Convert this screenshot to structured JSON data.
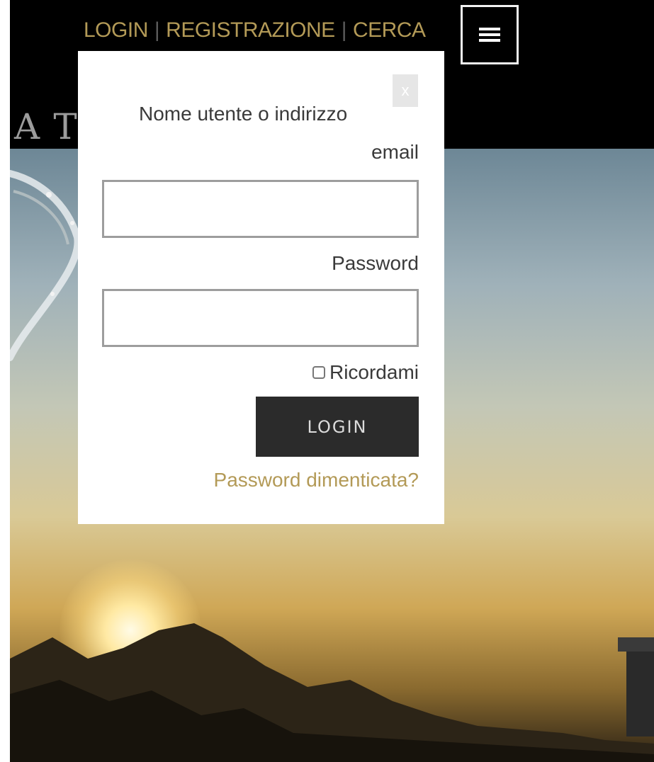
{
  "header": {
    "nav": {
      "login_label": "LOGIN",
      "separator": "|",
      "register_label": "REGISTRAZIONE",
      "search_label": "CERCA"
    },
    "menu_icon": "hamburger-menu-icon",
    "logo_fragment": "AT"
  },
  "login_panel": {
    "close_label": "x",
    "username_label_line1": "Nome utente o indirizzo",
    "username_label_line2": "email",
    "username_value": "",
    "password_label": "Password",
    "password_value": "",
    "remember_label": "Ricordami",
    "remember_checked": false,
    "login_button_label": "LOGIN",
    "forgot_password_link": "Password dimenticata?"
  },
  "colors": {
    "accent_gold": "#b39a57",
    "topbar": "#000000",
    "button_dark": "#2b2b2b",
    "panel_bg": "#ffffff"
  }
}
